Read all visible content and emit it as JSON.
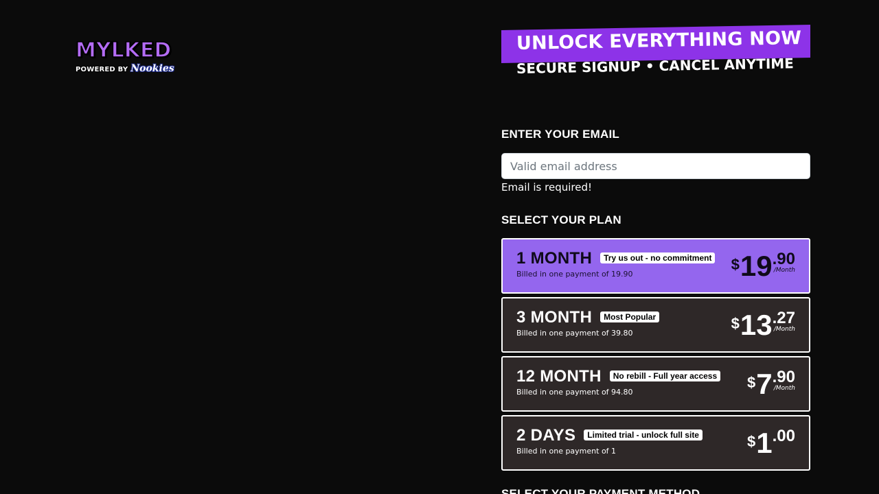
{
  "logo": {
    "main": "MYLKED",
    "powered_by": "POWERED BY",
    "brand": "Nookies"
  },
  "banner": {
    "line1": "UNLOCK EVERYTHING NOW",
    "line2": "SECURE SIGNUP • CANCEL ANYTIME"
  },
  "email": {
    "title": "ENTER YOUR EMAIL",
    "placeholder": "Valid email address",
    "value": "",
    "error": "Email is required!"
  },
  "plans_section": {
    "title": "SELECT YOUR PLAN"
  },
  "plans": [
    {
      "name": "1 MONTH",
      "badge": "Try us out - no commitment",
      "billed": "Billed in one payment of 19.90",
      "currency": "$",
      "whole": "19",
      "cents": ".90",
      "period": "/Month",
      "selected": true
    },
    {
      "name": "3 MONTH",
      "badge": "Most Popular",
      "billed": "Billed in one payment of 39.80",
      "currency": "$",
      "whole": "13",
      "cents": ".27",
      "period": "/Month",
      "selected": false
    },
    {
      "name": "12 MONTH",
      "badge": "No rebill - Full year access",
      "billed": "Billed in one payment of 94.80",
      "currency": "$",
      "whole": "7",
      "cents": ".90",
      "period": "/Month",
      "selected": false
    },
    {
      "name": "2 DAYS",
      "badge": "Limited trial - unlock full site",
      "billed": "Billed in one payment of 1",
      "currency": "$",
      "whole": "1",
      "cents": ".00",
      "period": "",
      "selected": false
    }
  ],
  "payment": {
    "title": "SELECT YOUR PAYMENT METHOD"
  },
  "colors": {
    "accent": "#8d33e8",
    "selected_plan": "#9466ee",
    "plan_bg": "#2e2828",
    "page_bg": "#0b0b0b"
  }
}
